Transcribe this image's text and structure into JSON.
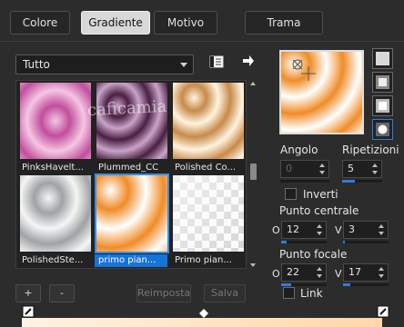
{
  "tabs": [
    {
      "label": "Colore",
      "active": false
    },
    {
      "label": "Gradiente",
      "active": true
    },
    {
      "label": "Motivo",
      "active": false
    },
    {
      "label": "Trama",
      "active": false
    }
  ],
  "category_dropdown": {
    "selected": "Tutto"
  },
  "gradients": [
    {
      "label": "PinksHavelt...",
      "selected": false
    },
    {
      "label": "Plummed_CC",
      "selected": false
    },
    {
      "label": "Polished Co...",
      "selected": false
    },
    {
      "label": "PolishedSte...",
      "selected": false
    },
    {
      "label": "primo pian...",
      "selected": true
    },
    {
      "label": "Primo pian...",
      "selected": false
    }
  ],
  "buttons": {
    "add": "+",
    "remove": "-",
    "reset": "Reimposta",
    "save": "Salva"
  },
  "settings": {
    "angle_label": "Angolo",
    "angle_value": "0",
    "repeats_label": "Ripetizioni",
    "repeats_value": "5",
    "invert_label": "Inverti",
    "invert_checked": false,
    "center_point_label": "Punto centrale",
    "center_o_label": "O",
    "center_o_value": "12",
    "center_v_label": "V",
    "center_v_value": "3",
    "focal_point_label": "Punto focale",
    "focal_o_label": "O",
    "focal_o_value": "22",
    "focal_v_label": "V",
    "focal_v_value": "17",
    "link_label": "Link",
    "link_checked": false
  },
  "watermark": "caficamia",
  "colors": {
    "accent": "#1673d8",
    "orange": "#f08c28"
  }
}
